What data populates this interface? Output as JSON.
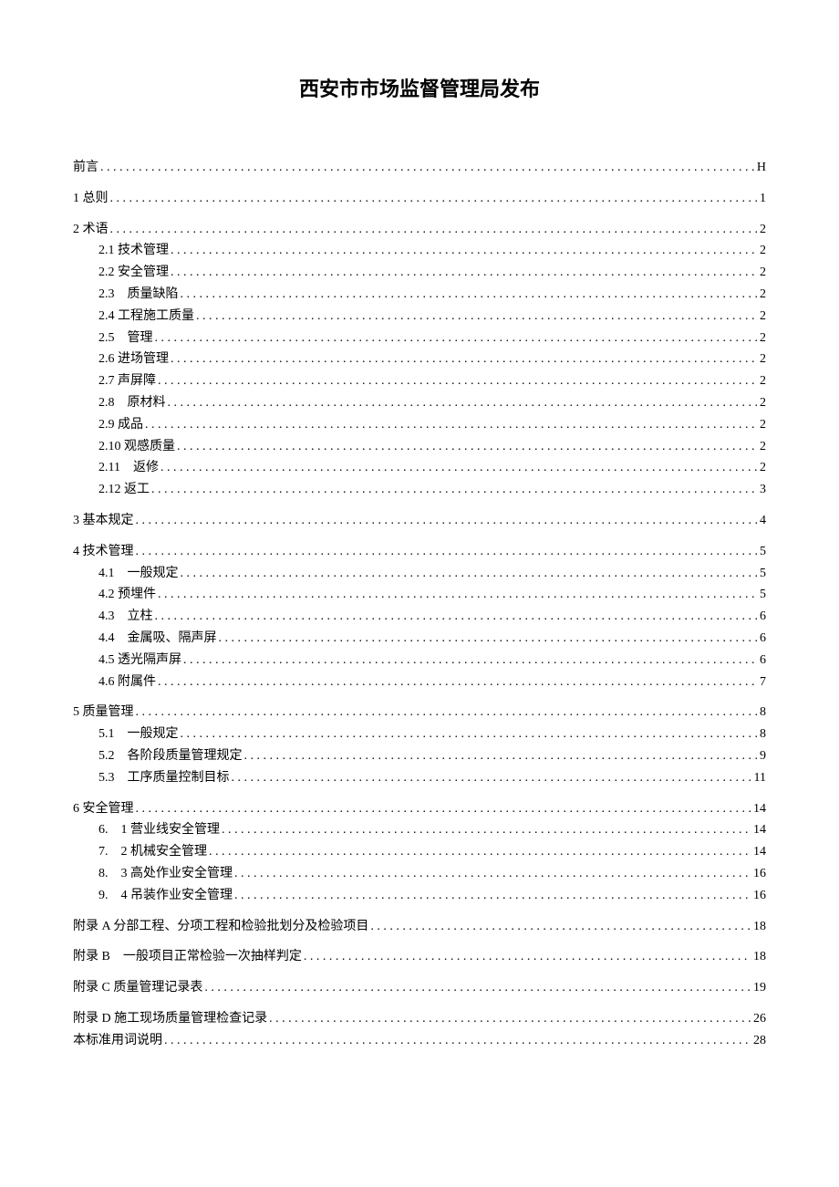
{
  "title": "西安市市场监督管理局发布",
  "toc": [
    {
      "level": 0,
      "label": "前言",
      "page": "H"
    },
    {
      "level": 0,
      "label": "1 总则",
      "page": "1"
    },
    {
      "level": 0,
      "label": "2 术语",
      "page": "2"
    },
    {
      "level": 1,
      "label": "2.1 技术管理",
      "page": "2"
    },
    {
      "level": 1,
      "label": "2.2 安全管理",
      "page": "2"
    },
    {
      "level": 1,
      "label": "2.3　质量缺陷",
      "page": "2"
    },
    {
      "level": 1,
      "label": "2.4 工程施工质量",
      "page": "2"
    },
    {
      "level": 1,
      "label": "2.5　管理",
      "page": "2"
    },
    {
      "level": 1,
      "label": "2.6 进场管理",
      "page": "2"
    },
    {
      "level": 1,
      "label": "2.7 声屏障",
      "page": "2"
    },
    {
      "level": 1,
      "label": "2.8　原材料",
      "page": "2"
    },
    {
      "level": 1,
      "label": "2.9 成品",
      "page": "2"
    },
    {
      "level": 1,
      "label": "2.10 观感质量",
      "page": "2"
    },
    {
      "level": 1,
      "label": "2.11　返修",
      "page": "2"
    },
    {
      "level": 1,
      "label": "2.12 返工",
      "page": "3"
    },
    {
      "level": 0,
      "label": "3 基本规定",
      "page": "4"
    },
    {
      "level": 0,
      "label": "4 技术管理",
      "page": "5"
    },
    {
      "level": 1,
      "label": "4.1　一般规定",
      "page": "5"
    },
    {
      "level": 1,
      "label": "4.2 预埋件",
      "page": "5"
    },
    {
      "level": 1,
      "label": "4.3　立柱",
      "page": "6"
    },
    {
      "level": 1,
      "label": "4.4　金属吸、隔声屏",
      "page": "6"
    },
    {
      "level": 1,
      "label": "4.5 透光隔声屏",
      "page": "6"
    },
    {
      "level": 1,
      "label": "4.6 附属件",
      "page": "7"
    },
    {
      "level": 0,
      "label": "5 质量管理",
      "page": "8"
    },
    {
      "level": 1,
      "label": "5.1　一般规定",
      "page": "8"
    },
    {
      "level": 1,
      "label": "5.2　各阶段质量管理规定",
      "page": "9"
    },
    {
      "level": 1,
      "label": "5.3　工序质量控制目标",
      "page": "11"
    },
    {
      "level": 0,
      "label": "6 安全管理",
      "page": "14"
    },
    {
      "level": 1,
      "label": "6.　1 营业线安全管理",
      "page": "14"
    },
    {
      "level": 1,
      "label": "7.　2 机械安全管理",
      "page": "14"
    },
    {
      "level": 1,
      "label": "8.　3 高处作业安全管理",
      "page": "16"
    },
    {
      "level": 1,
      "label": "9.　4 吊装作业安全管理",
      "page": "16"
    },
    {
      "level": 0,
      "label": "附录 A 分部工程、分项工程和检验批划分及检验项目",
      "page": "18"
    },
    {
      "level": 0,
      "label": "附录 B　一般项目正常检验一次抽样判定",
      "page": "18"
    },
    {
      "level": 0,
      "label": "附录 C 质量管理记录表",
      "page": "19"
    },
    {
      "level": 0,
      "label": "附录 D 施工现场质量管理检查记录",
      "page": "26"
    },
    {
      "level": 0,
      "label": "本标准用词说明",
      "page": "28",
      "nomargin": true
    }
  ]
}
